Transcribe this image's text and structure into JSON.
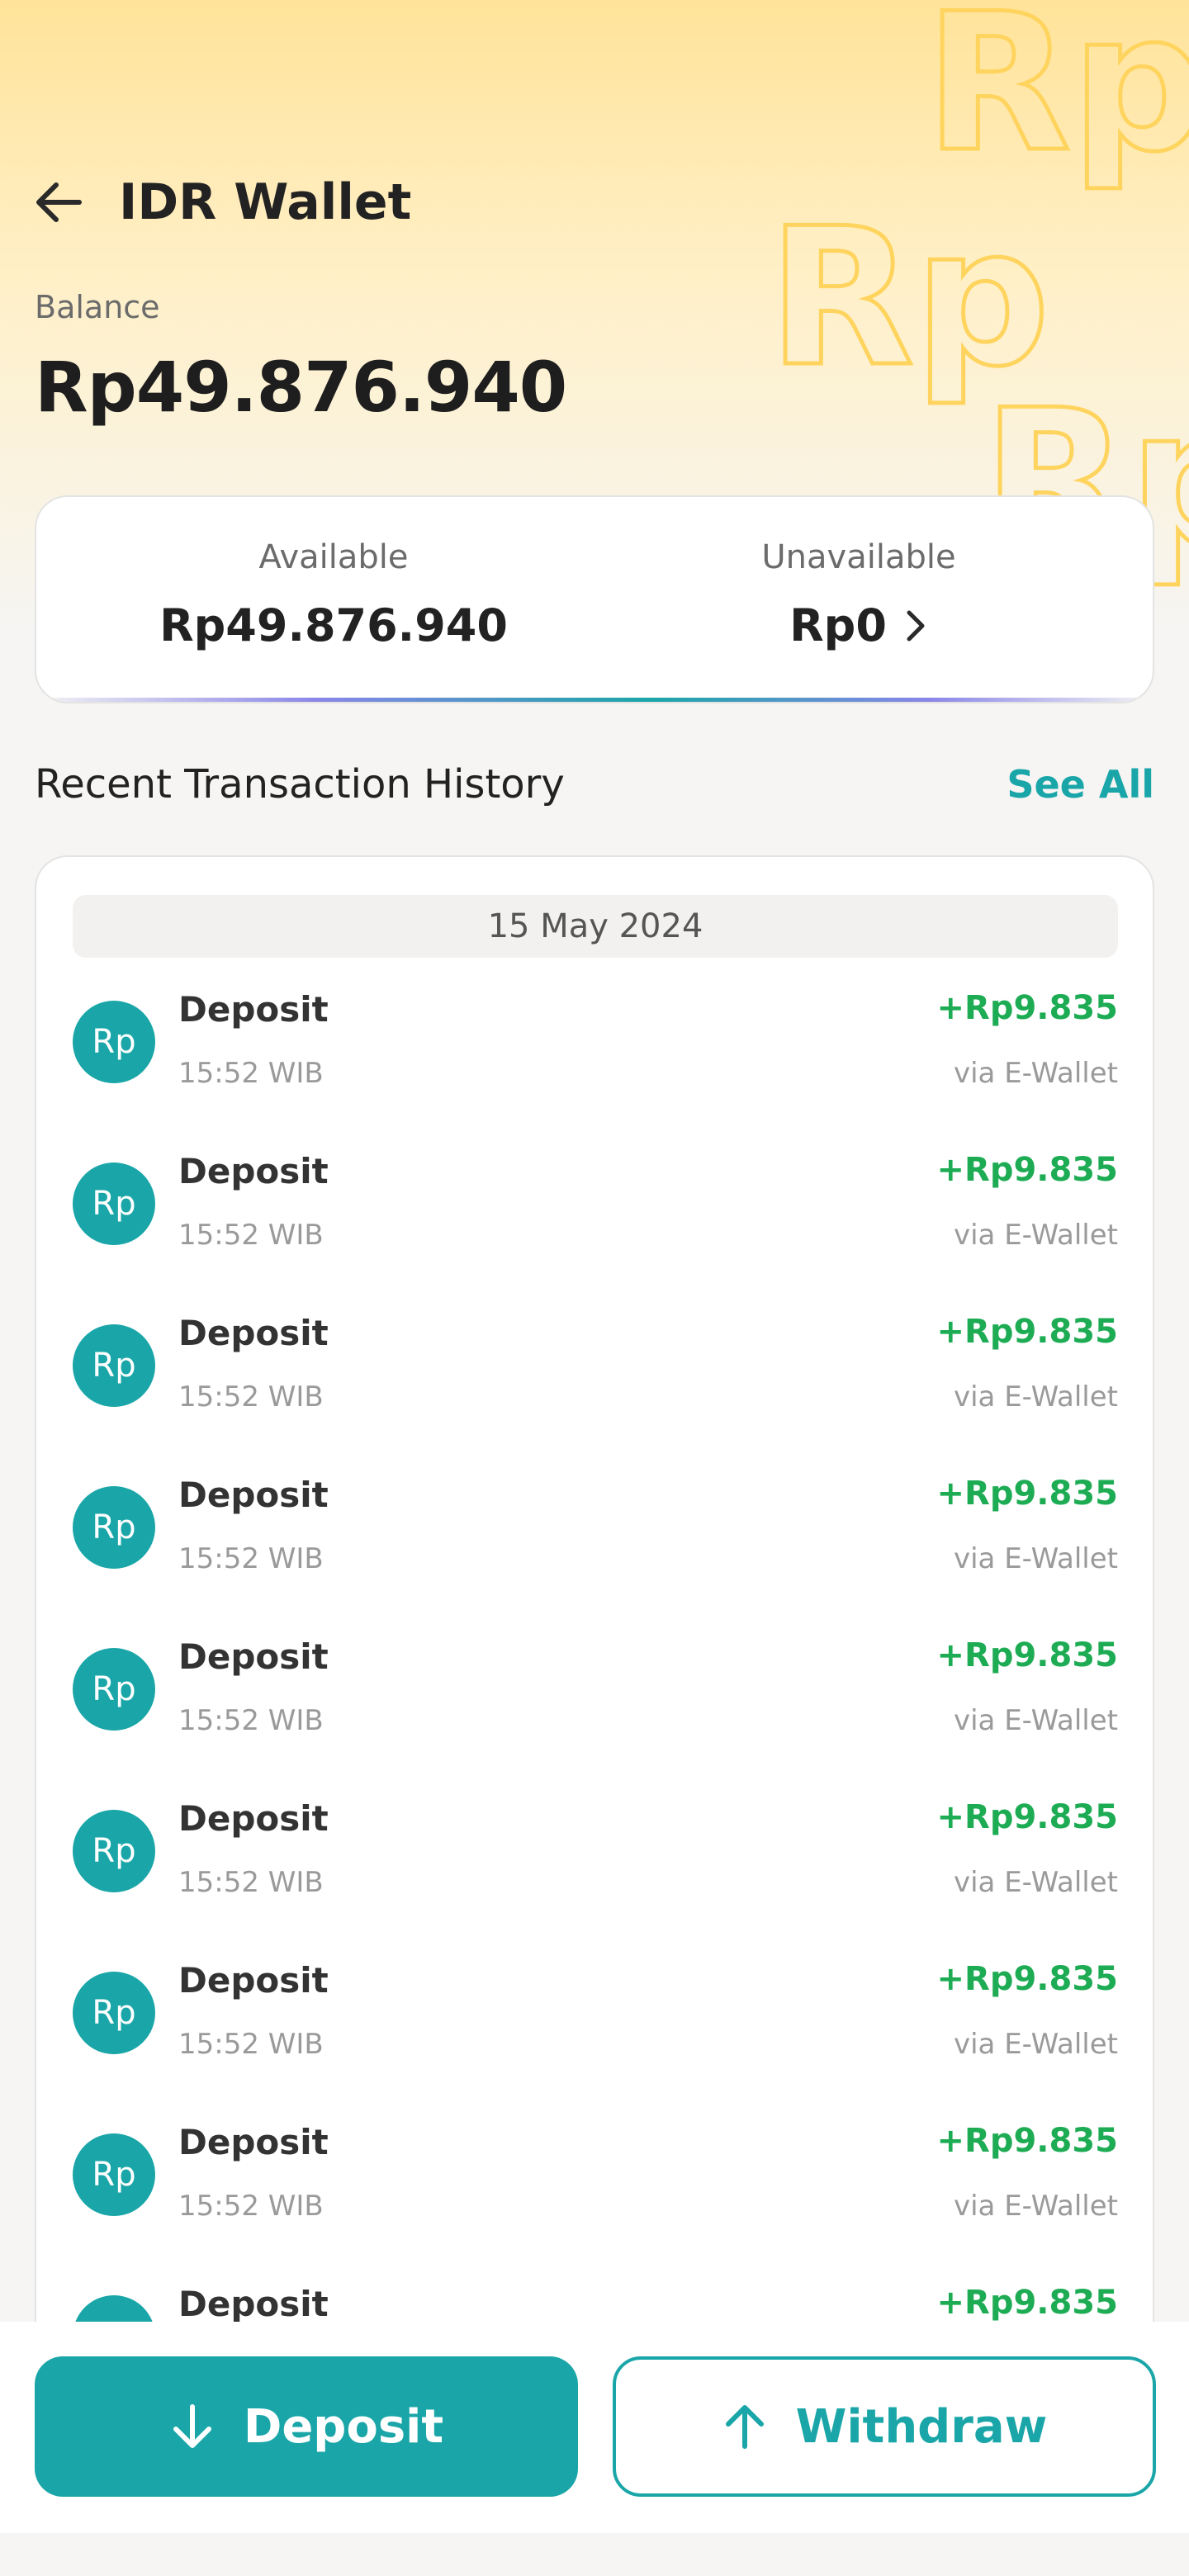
{
  "header": {
    "title": "IDR Wallet"
  },
  "balance": {
    "label": "Balance",
    "amount": "Rp49.876.940"
  },
  "summary": {
    "available_label": "Available",
    "available_value": "Rp49.876.940",
    "unavailable_label": "Unavailable",
    "unavailable_value": "Rp0"
  },
  "history": {
    "title": "Recent Transaction History",
    "see_all": "See All",
    "date": "15 May 2024",
    "avatar_text": "Rp",
    "rows": [
      {
        "type": "Deposit",
        "time": "15:52 WIB",
        "amount": "+Rp9.835",
        "method": "via E-Wallet"
      },
      {
        "type": "Deposit",
        "time": "15:52 WIB",
        "amount": "+Rp9.835",
        "method": "via E-Wallet"
      },
      {
        "type": "Deposit",
        "time": "15:52 WIB",
        "amount": "+Rp9.835",
        "method": "via E-Wallet"
      },
      {
        "type": "Deposit",
        "time": "15:52 WIB",
        "amount": "+Rp9.835",
        "method": "via E-Wallet"
      },
      {
        "type": "Deposit",
        "time": "15:52 WIB",
        "amount": "+Rp9.835",
        "method": "via E-Wallet"
      },
      {
        "type": "Deposit",
        "time": "15:52 WIB",
        "amount": "+Rp9.835",
        "method": "via E-Wallet"
      },
      {
        "type": "Deposit",
        "time": "15:52 WIB",
        "amount": "+Rp9.835",
        "method": "via E-Wallet"
      },
      {
        "type": "Deposit",
        "time": "15:52 WIB",
        "amount": "+Rp9.835",
        "method": "via E-Wallet"
      },
      {
        "type": "Deposit",
        "time": "",
        "amount": "+Rp9.835",
        "method": ""
      }
    ]
  },
  "actions": {
    "deposit_label": "Deposit",
    "withdraw_label": "Withdraw"
  },
  "colors": {
    "accent": "#1aa6a8",
    "positive": "#1dac54",
    "hero": "#ffe39a"
  }
}
